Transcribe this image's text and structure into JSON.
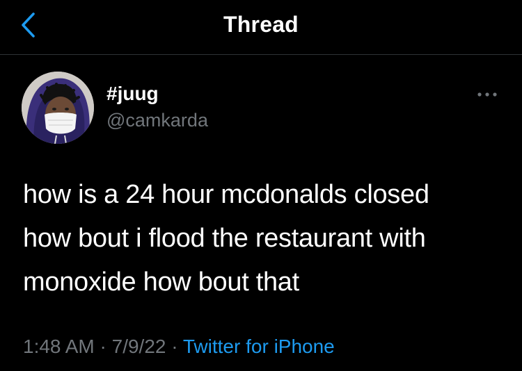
{
  "header": {
    "title": "Thread",
    "back_icon": "chevron-left-icon",
    "accent_color": "#1d9bf0"
  },
  "tweet": {
    "display_name": "#juug",
    "handle": "@camkarda",
    "text_lines": [
      "how is a 24 hour mcdonalds closed",
      "how bout i flood the restaurant with",
      "monoxide how bout that"
    ],
    "time": "1:48 AM",
    "separator": "·",
    "date": "7/9/22",
    "source": "Twitter for iPhone",
    "more_icon": "more-horizontal-icon"
  },
  "colors": {
    "background": "#000000",
    "text": "#ffffff",
    "secondary_text": "#71767b",
    "link": "#1d9bf0",
    "divider": "#2f3336"
  }
}
